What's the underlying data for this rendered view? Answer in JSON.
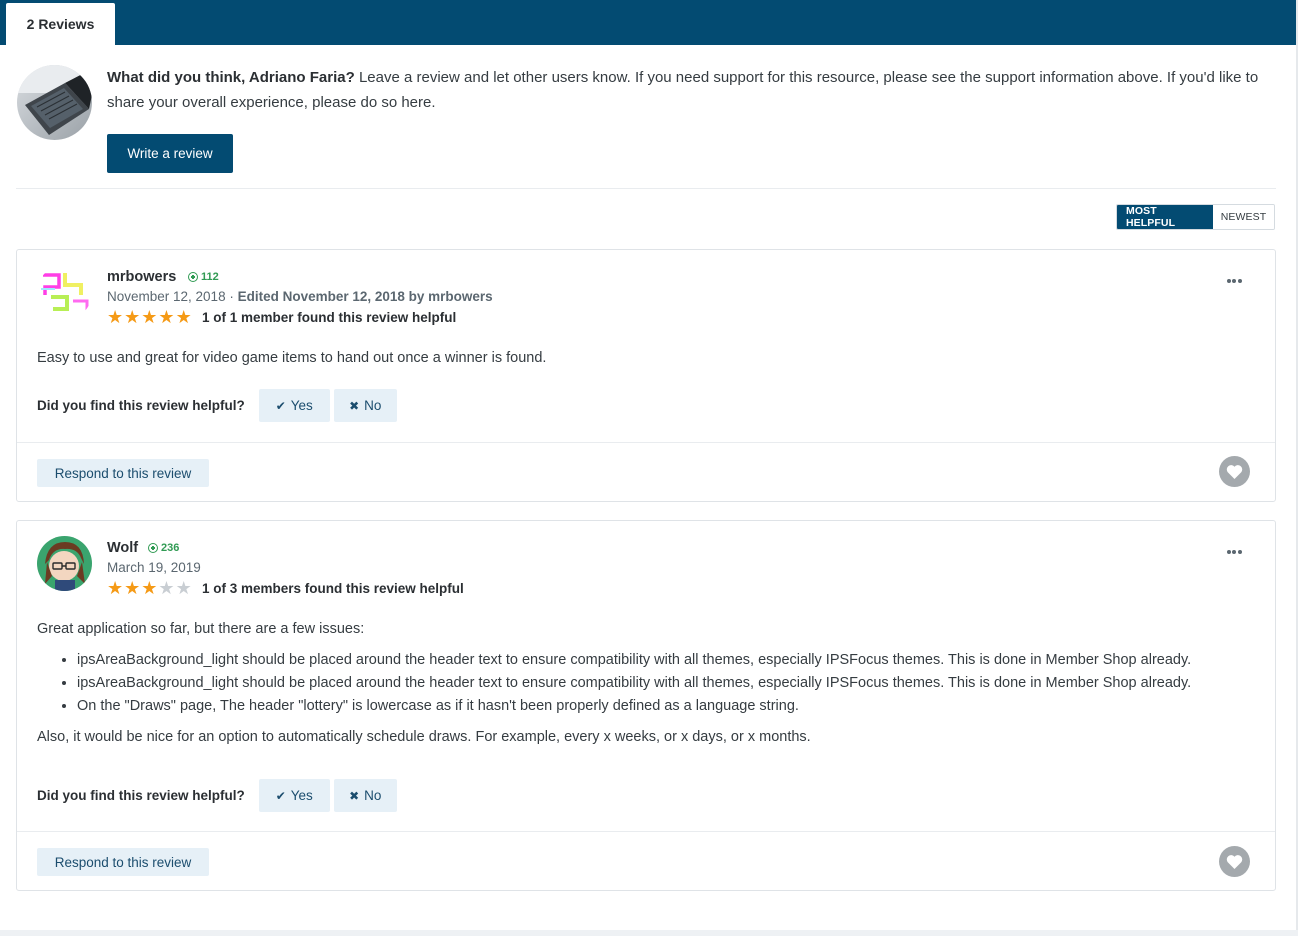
{
  "tabs": {
    "reviews_tab": "2 Reviews"
  },
  "intro": {
    "question": "What did you think, Adriano Faria?",
    "text": " Leave a review and let other users know. If you need support for this resource, please see the support information above. If you'd like to share your overall experience, please do so here.",
    "write_button": "Write a review"
  },
  "sort": {
    "most_helpful": "MOST HELPFUL",
    "newest": "NEWEST",
    "selected": "MOST HELPFUL"
  },
  "reviews": [
    {
      "author": "mrbowers",
      "reputation": "112",
      "date": "November 12, 2018",
      "edited": "Edited November 12, 2018 by mrbowers",
      "rating": 5,
      "helpful_count": "1 of 1 member found this review helpful",
      "body": "Easy to use and great for video game items to hand out once a winner is found.",
      "helpful_question": "Did you find this review helpful?",
      "yes_label": "Yes",
      "no_label": "No",
      "respond_label": "Respond to this review"
    },
    {
      "author": "Wolf",
      "reputation": "236",
      "date": "March 19, 2019",
      "rating": 3,
      "helpful_count": "1 of 3 members found this review helpful",
      "body_intro": "Great application so far, but there are a few issues:",
      "bullets": [
        "ipsAreaBackground_light should be placed around the header text to ensure compatibility with all themes, especially IPSFocus themes. This is done in Member Shop already.",
        "ipsAreaBackground_light should be placed around the header text to ensure compatibility with all themes, especially IPSFocus themes. This is done in Member Shop already.",
        "On the \"Draws\" page, The header \"lottery\" is lowercase as if it hasn't been properly defined as a language string."
      ],
      "body_outro": "Also, it would be nice for an option to automatically schedule draws. For example, every x weeks, or x days, or x months.",
      "helpful_question": "Did you find this review helpful?",
      "yes_label": "Yes",
      "no_label": "No",
      "respond_label": "Respond to this review"
    }
  ],
  "icons": {
    "reputation": "plus-circle-icon",
    "yes": "checkmark-icon",
    "no": "x-icon",
    "more": "ellipsis-icon",
    "like": "heart-icon",
    "star": "star-icon"
  },
  "colors": {
    "header_bar": "#034b72",
    "primary_button": "#034b72",
    "star_on": "#f59a16",
    "star_off": "#c9ced3",
    "reputation": "#319b54",
    "light_button": "#e6f0f7"
  }
}
